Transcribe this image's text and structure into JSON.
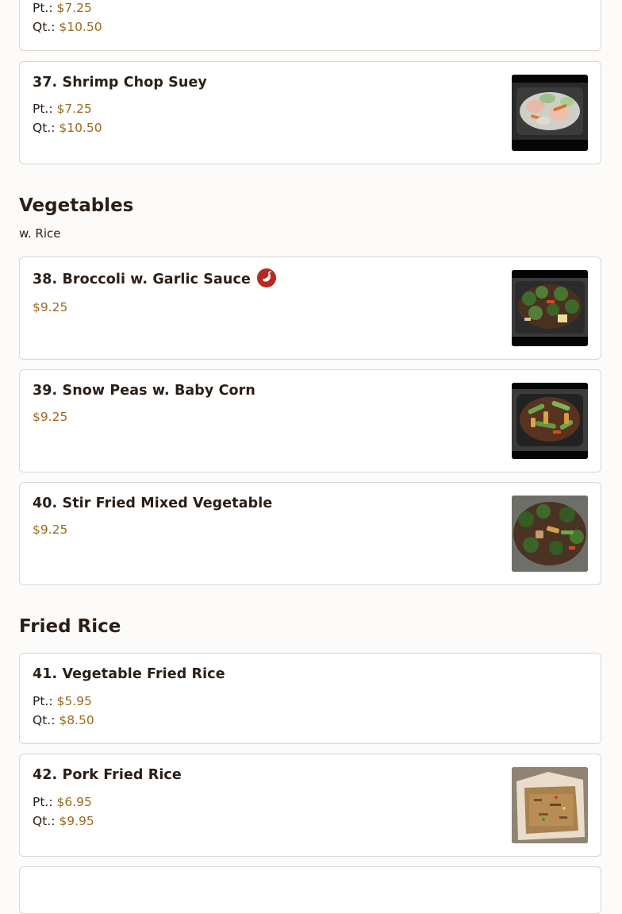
{
  "items": {
    "i36": {
      "pt_label": "Pt.:",
      "pt_price": "$7.25",
      "qt_label": "Qt.:",
      "qt_price": "$10.50"
    },
    "i37": {
      "title": "37. Shrimp Chop Suey",
      "pt_label": "Pt.:",
      "pt_price": "$7.25",
      "qt_label": "Qt.:",
      "qt_price": "$10.50",
      "image": "shrimp-chop-suey-photo"
    },
    "i38": {
      "title": "38. Broccoli w. Garlic Sauce",
      "price": "$9.25",
      "badge": "spicy-pepper-icon",
      "image": "broccoli-garlic-sauce-photo"
    },
    "i39": {
      "title": "39. Snow Peas w. Baby Corn",
      "price": "$9.25",
      "image": "snow-peas-baby-corn-photo"
    },
    "i40": {
      "title": "40. Stir Fried Mixed Vegetable",
      "price": "$9.25",
      "image": "stir-fried-mixed-vegetable-photo"
    },
    "i41": {
      "title": "41. Vegetable Fried Rice",
      "pt_label": "Pt.:",
      "pt_price": "$5.95",
      "qt_label": "Qt.:",
      "qt_price": "$8.50"
    },
    "i42": {
      "title": "42. Pork Fried Rice",
      "pt_label": "Pt.:",
      "pt_price": "$6.95",
      "qt_label": "Qt.:",
      "qt_price": "$9.95",
      "image": "pork-fried-rice-photo"
    }
  },
  "sections": {
    "vegetables": {
      "title": "Vegetables",
      "subtitle": "w. Rice"
    },
    "fried_rice": {
      "title": "Fried Rice"
    }
  },
  "colors": {
    "price": "#9a6a1f",
    "text": "#2a1e16",
    "spicy": "#b72a23",
    "border": "#d9d6d2"
  }
}
